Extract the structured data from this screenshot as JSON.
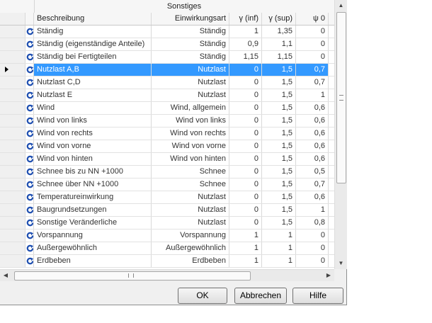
{
  "grid": {
    "group_header": "Sonstiges",
    "columns": {
      "beschreibung": "Beschreibung",
      "einwirkungsart": "Einwirkungsart",
      "gamma_inf": "γ (inf)",
      "gamma_sup": "γ (sup)",
      "psi0": "ψ 0"
    },
    "selected_row": "Nutzlast A,B",
    "rows": [
      {
        "beschreibung": "Ständig",
        "einwirkungsart": "Ständig",
        "gamma_inf": "1",
        "gamma_sup": "1,35",
        "psi0": "0"
      },
      {
        "beschreibung": "Ständig (eigenständige Anteile)",
        "einwirkungsart": "Ständig",
        "gamma_inf": "0,9",
        "gamma_sup": "1,1",
        "psi0": "0"
      },
      {
        "beschreibung": "Ständig bei Fertigteilen",
        "einwirkungsart": "Ständig",
        "gamma_inf": "1,15",
        "gamma_sup": "1,15",
        "psi0": "0"
      },
      {
        "beschreibung": "Nutzlast A,B",
        "einwirkungsart": "Nutzlast",
        "gamma_inf": "0",
        "gamma_sup": "1,5",
        "psi0": "0,7"
      },
      {
        "beschreibung": "Nutzlast C,D",
        "einwirkungsart": "Nutzlast",
        "gamma_inf": "0",
        "gamma_sup": "1,5",
        "psi0": "0,7"
      },
      {
        "beschreibung": "Nutzlast E",
        "einwirkungsart": "Nutzlast",
        "gamma_inf": "0",
        "gamma_sup": "1,5",
        "psi0": "1"
      },
      {
        "beschreibung": "Wind",
        "einwirkungsart": "Wind, allgemein",
        "gamma_inf": "0",
        "gamma_sup": "1,5",
        "psi0": "0,6"
      },
      {
        "beschreibung": "Wind von links",
        "einwirkungsart": "Wind von links",
        "gamma_inf": "0",
        "gamma_sup": "1,5",
        "psi0": "0,6"
      },
      {
        "beschreibung": "Wind von rechts",
        "einwirkungsart": "Wind von rechts",
        "gamma_inf": "0",
        "gamma_sup": "1,5",
        "psi0": "0,6"
      },
      {
        "beschreibung": "Wind von vorne",
        "einwirkungsart": "Wind von vorne",
        "gamma_inf": "0",
        "gamma_sup": "1,5",
        "psi0": "0,6"
      },
      {
        "beschreibung": "Wind von hinten",
        "einwirkungsart": "Wind von hinten",
        "gamma_inf": "0",
        "gamma_sup": "1,5",
        "psi0": "0,6"
      },
      {
        "beschreibung": "Schnee bis zu NN +1000",
        "einwirkungsart": "Schnee",
        "gamma_inf": "0",
        "gamma_sup": "1,5",
        "psi0": "0,5"
      },
      {
        "beschreibung": "Schnee über NN +1000",
        "einwirkungsart": "Schnee",
        "gamma_inf": "0",
        "gamma_sup": "1,5",
        "psi0": "0,7"
      },
      {
        "beschreibung": "Temperatureinwirkung",
        "einwirkungsart": "Nutzlast",
        "gamma_inf": "0",
        "gamma_sup": "1,5",
        "psi0": "0,6"
      },
      {
        "beschreibung": "Baugrundsetzungen",
        "einwirkungsart": "Nutzlast",
        "gamma_inf": "0",
        "gamma_sup": "1,5",
        "psi0": "1"
      },
      {
        "beschreibung": "Sonstige Veränderliche",
        "einwirkungsart": "Nutzlast",
        "gamma_inf": "0",
        "gamma_sup": "1,5",
        "psi0": "0,8"
      },
      {
        "beschreibung": "Vorspannung",
        "einwirkungsart": "Vorspannung",
        "gamma_inf": "1",
        "gamma_sup": "1",
        "psi0": "0"
      },
      {
        "beschreibung": "Außergewöhnlich",
        "einwirkungsart": "Außergewöhnlich",
        "gamma_inf": "1",
        "gamma_sup": "1",
        "psi0": "0"
      },
      {
        "beschreibung": "Erdbeben",
        "einwirkungsart": "Erdbeben",
        "gamma_inf": "1",
        "gamma_sup": "1",
        "psi0": "0"
      }
    ]
  },
  "scrollbars": {
    "vertical": {
      "up": "▲",
      "down": "▼",
      "grip": "≡"
    },
    "horizontal": {
      "left": "◀",
      "right": "▶",
      "grip": "III"
    }
  },
  "buttons": {
    "ok": "OK",
    "cancel": "Abbrechen",
    "help": "Hilfe"
  },
  "colors": {
    "selection": "#3399ff",
    "row_icon": "#1f4fb0"
  },
  "icons": {
    "row": "refresh-icon",
    "current_row": "row-pointer-icon"
  }
}
